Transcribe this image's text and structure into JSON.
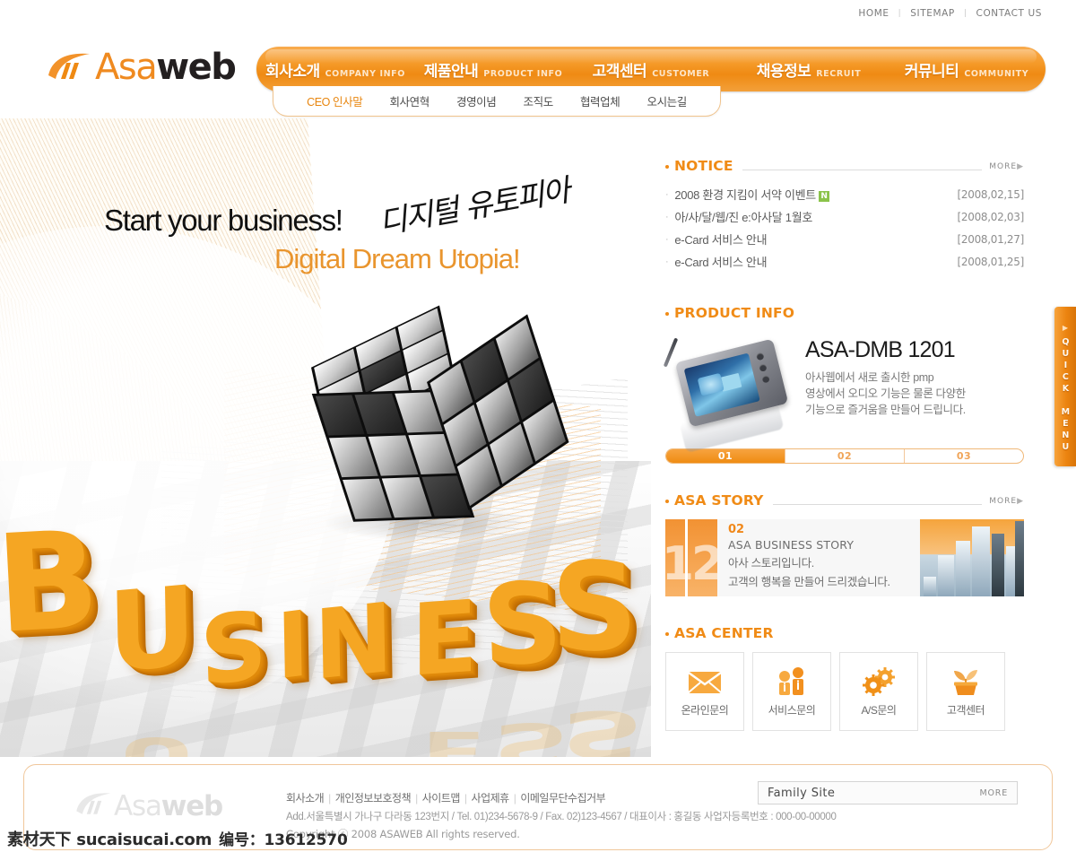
{
  "utility": {
    "links": [
      "HOME",
      "SITEMAP",
      "CONTACT US"
    ],
    "separator": "|"
  },
  "logo": {
    "asa": "Asa",
    "web": "web"
  },
  "nav": {
    "items": [
      {
        "ko": "회사소개",
        "en": "COMPANY INFO"
      },
      {
        "ko": "제품안내",
        "en": "PRODUCT INFO"
      },
      {
        "ko": "고객센터",
        "en": "CUSTOMER"
      },
      {
        "ko": "채용정보",
        "en": "RECRUIT"
      },
      {
        "ko": "커뮤니티",
        "en": "COMMUNITY"
      }
    ],
    "sub": [
      {
        "label": "CEO 인사말",
        "active": true
      },
      {
        "label": "회사연혁",
        "active": false
      },
      {
        "label": "경영이념",
        "active": false
      },
      {
        "label": "조직도",
        "active": false
      },
      {
        "label": "협력업체",
        "active": false
      },
      {
        "label": "오시는길",
        "active": false
      }
    ]
  },
  "hero": {
    "line1": "Start your business!",
    "script": "디지털 유토피아",
    "line2": "Digital Dream Utopia!",
    "word": "BUSINESS"
  },
  "notice": {
    "title": "NOTICE",
    "more": "MORE",
    "more_arrow": "▶",
    "items": [
      {
        "title": "2008 환경 지킴이 서약 이벤트",
        "badge": "N",
        "date": "[2008,02,15]"
      },
      {
        "title": "아/사/달/웹/진 e:아사달 1월호",
        "badge": "",
        "date": "[2008,02,03]"
      },
      {
        "title": "e-Card 서비스 안내",
        "badge": "",
        "date": "[2008,01,27]"
      },
      {
        "title": "e-Card 서비스 안내",
        "badge": "",
        "date": "[2008,01,25]"
      }
    ]
  },
  "product": {
    "title": "PRODUCT INFO",
    "name": "ASA-DMB 1201",
    "desc_line1": "아사웹에서 새로 출시한 pmp",
    "desc_line2": "영상에서 오디오 기능은 물론 다양한",
    "desc_line3": "기능으로 즐거움을 만들어 드립니다.",
    "pager": [
      {
        "label": "01",
        "active": true
      },
      {
        "label": "02",
        "active": false
      },
      {
        "label": "03",
        "active": false
      }
    ]
  },
  "story": {
    "title": "ASA STORY",
    "more": "MORE",
    "more_arrow": "▶",
    "bignum": "12",
    "index": "02",
    "line1": "ASA BUSINESS STORY",
    "line2": "아사 스토리입니다.",
    "line3": "고객의 행복을 만들어 드리겠습니다."
  },
  "center": {
    "title": "ASA CENTER",
    "items": [
      {
        "label": "온라인문의",
        "icon": "envelope-icon"
      },
      {
        "label": "서비스문의",
        "icon": "people-info-icon"
      },
      {
        "label": "A/S문의",
        "icon": "gears-icon"
      },
      {
        "label": "고객센터",
        "icon": "plant-pot-icon"
      }
    ]
  },
  "quick_menu": {
    "arrow": "▶",
    "label": "QUICK MENU"
  },
  "footer": {
    "logo_asa": "Asa",
    "logo_web": "web",
    "links": [
      "회사소개",
      "개인정보보호정책",
      "사이트맵",
      "사업제휴",
      "이메일무단수집거부"
    ],
    "separator": "|",
    "address": "Add.서울특별시 가나구 다라동 123번지 / Tel. 01)234-5678-9 / Fax. 02)123-4567 / 대표이사 : 홍길동  사업자등록번호 : 000-00-00000",
    "copyright": "Copyright ⓒ 2008 ASAWEB  All rights reserved.",
    "family_site": "Family  Site",
    "family_more": "MORE"
  },
  "watermark": {
    "site": "素材天下 sucaisucai.com",
    "id": "编号：13612570"
  },
  "colors": {
    "brand_orange": "#ef8a13",
    "accent_orange": "#f5a623",
    "title_orange": "#f08b16",
    "badge_green": "#8bc34a",
    "text_gray": "#6b6b6b"
  }
}
